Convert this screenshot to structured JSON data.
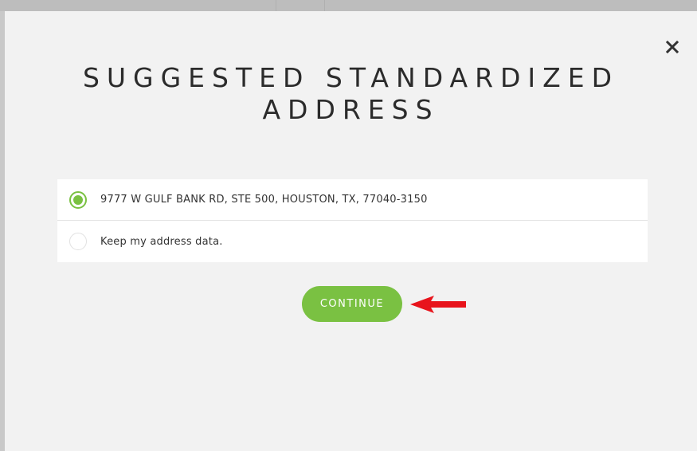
{
  "dialog": {
    "title_line1": "SUGGESTED STANDARDIZED",
    "title_line2": "ADDRESS",
    "close_icon": "close-icon",
    "options": [
      {
        "label": "9777 W GULF BANK RD, STE 500, HOUSTON, TX, 77040-3150",
        "selected": true
      },
      {
        "label": "Keep my address data.",
        "selected": false
      }
    ],
    "continue_label": "CONTINUE"
  },
  "annotation": {
    "icon": "red-arrow-left-icon",
    "color": "#e8141c"
  },
  "colors": {
    "accent": "#7ac142",
    "background": "#f2f2f2",
    "text": "#2b2b2b"
  }
}
